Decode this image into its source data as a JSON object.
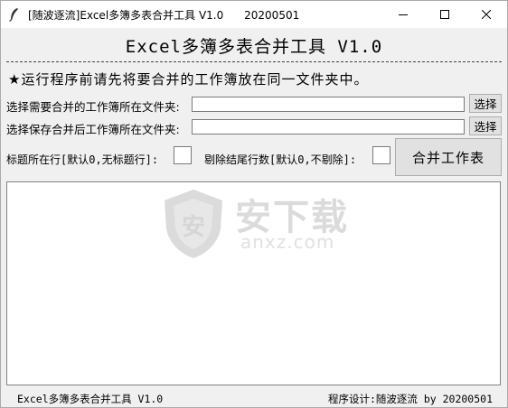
{
  "window": {
    "title": "[随波逐流]Excel多簿多表合并工具 V1.0      20200501",
    "min_icon": "minimize-icon",
    "max_icon": "maximize-icon",
    "close_icon": "close-icon"
  },
  "header": {
    "title": "Excel多簿多表合并工具 V1.0"
  },
  "notice": "★运行程序前请先将要合并的工作簿放在同一文件夹中。",
  "source_folder": {
    "label": "选择需要合并的工作簿所在文件夹:",
    "value": "",
    "button": "选择"
  },
  "output_folder": {
    "label": "选择保存合并后工作簿所在文件夹:",
    "value": "",
    "button": "选择"
  },
  "options": {
    "header_row_label": "标题所在行[默认0,无标题行]:",
    "header_row_value": "",
    "tail_rows_label": "剔除结尾行数[默认0,不剔除]:",
    "tail_rows_value": ""
  },
  "merge_button": "合并工作表",
  "watermark": {
    "text": "安下载",
    "sub": "anxz.com"
  },
  "footer": {
    "left": "Excel多簿多表合并工具 V1.0",
    "right": "程序设计:随波逐流 by 20200501"
  }
}
